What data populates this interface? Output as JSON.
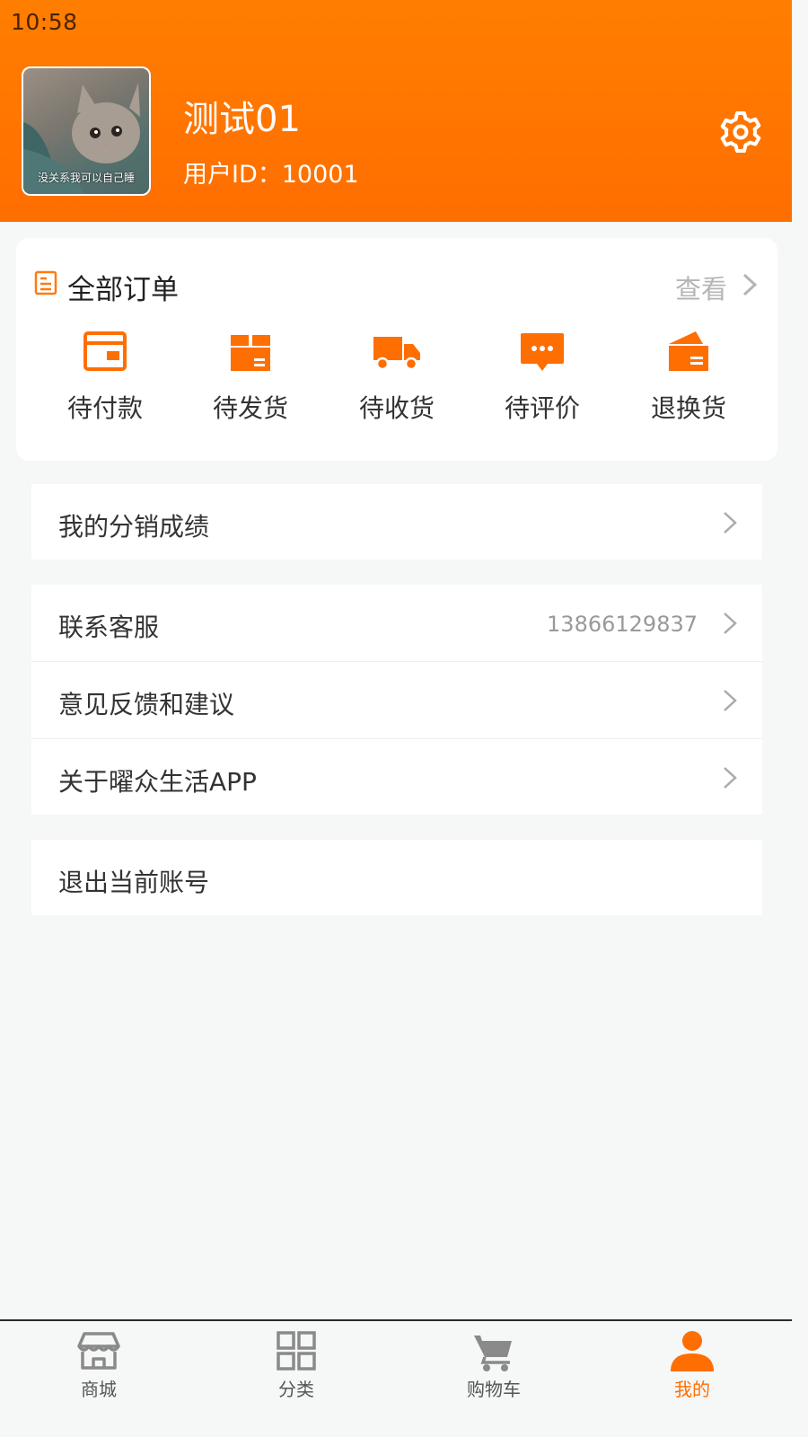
{
  "status_bar": {
    "time": "10:58"
  },
  "profile": {
    "avatar_caption": "没关系我可以自己睡",
    "name": "测试01",
    "user_id": "用户ID：10001",
    "settings_icon": "gear-icon"
  },
  "orders": {
    "title": "全部订单",
    "view_label": "查看",
    "items": [
      {
        "label": "待付款",
        "icon": "wallet-icon"
      },
      {
        "label": "待发货",
        "icon": "box-icon"
      },
      {
        "label": "待收货",
        "icon": "truck-icon"
      },
      {
        "label": "待评价",
        "icon": "comment-icon"
      },
      {
        "label": "退换货",
        "icon": "return-icon"
      }
    ]
  },
  "menu": {
    "distribution": {
      "label": "我的分销成绩"
    },
    "contact": {
      "label": "联系客服",
      "value": "13866129837"
    },
    "feedback": {
      "label": "意见反馈和建议"
    },
    "about": {
      "label": "关于曜众生活APP"
    },
    "logout": {
      "label": "退出当前账号"
    }
  },
  "tabbar": {
    "items": [
      {
        "label": "商城",
        "icon": "store-icon"
      },
      {
        "label": "分类",
        "icon": "grid-icon"
      },
      {
        "label": "购物车",
        "icon": "cart-icon"
      },
      {
        "label": "我的",
        "icon": "user-icon",
        "active": true
      }
    ]
  },
  "colors": {
    "accent": "#ff6e00",
    "header_gradient_top": "#ff7e00",
    "background": "#f6f7f7"
  }
}
